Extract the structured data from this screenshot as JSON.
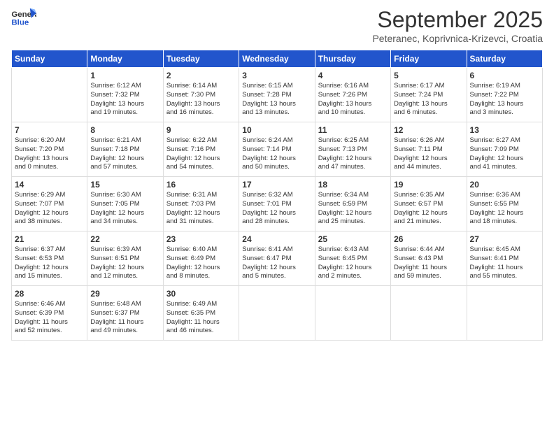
{
  "header": {
    "logo_line1": "General",
    "logo_line2": "Blue",
    "month": "September 2025",
    "location": "Peteranec, Koprivnica-Krizevci, Croatia"
  },
  "weekdays": [
    "Sunday",
    "Monday",
    "Tuesday",
    "Wednesday",
    "Thursday",
    "Friday",
    "Saturday"
  ],
  "weeks": [
    [
      {
        "day": "",
        "content": ""
      },
      {
        "day": "1",
        "content": "Sunrise: 6:12 AM\nSunset: 7:32 PM\nDaylight: 13 hours\nand 19 minutes."
      },
      {
        "day": "2",
        "content": "Sunrise: 6:14 AM\nSunset: 7:30 PM\nDaylight: 13 hours\nand 16 minutes."
      },
      {
        "day": "3",
        "content": "Sunrise: 6:15 AM\nSunset: 7:28 PM\nDaylight: 13 hours\nand 13 minutes."
      },
      {
        "day": "4",
        "content": "Sunrise: 6:16 AM\nSunset: 7:26 PM\nDaylight: 13 hours\nand 10 minutes."
      },
      {
        "day": "5",
        "content": "Sunrise: 6:17 AM\nSunset: 7:24 PM\nDaylight: 13 hours\nand 6 minutes."
      },
      {
        "day": "6",
        "content": "Sunrise: 6:19 AM\nSunset: 7:22 PM\nDaylight: 13 hours\nand 3 minutes."
      }
    ],
    [
      {
        "day": "7",
        "content": "Sunrise: 6:20 AM\nSunset: 7:20 PM\nDaylight: 13 hours\nand 0 minutes."
      },
      {
        "day": "8",
        "content": "Sunrise: 6:21 AM\nSunset: 7:18 PM\nDaylight: 12 hours\nand 57 minutes."
      },
      {
        "day": "9",
        "content": "Sunrise: 6:22 AM\nSunset: 7:16 PM\nDaylight: 12 hours\nand 54 minutes."
      },
      {
        "day": "10",
        "content": "Sunrise: 6:24 AM\nSunset: 7:14 PM\nDaylight: 12 hours\nand 50 minutes."
      },
      {
        "day": "11",
        "content": "Sunrise: 6:25 AM\nSunset: 7:13 PM\nDaylight: 12 hours\nand 47 minutes."
      },
      {
        "day": "12",
        "content": "Sunrise: 6:26 AM\nSunset: 7:11 PM\nDaylight: 12 hours\nand 44 minutes."
      },
      {
        "day": "13",
        "content": "Sunrise: 6:27 AM\nSunset: 7:09 PM\nDaylight: 12 hours\nand 41 minutes."
      }
    ],
    [
      {
        "day": "14",
        "content": "Sunrise: 6:29 AM\nSunset: 7:07 PM\nDaylight: 12 hours\nand 38 minutes."
      },
      {
        "day": "15",
        "content": "Sunrise: 6:30 AM\nSunset: 7:05 PM\nDaylight: 12 hours\nand 34 minutes."
      },
      {
        "day": "16",
        "content": "Sunrise: 6:31 AM\nSunset: 7:03 PM\nDaylight: 12 hours\nand 31 minutes."
      },
      {
        "day": "17",
        "content": "Sunrise: 6:32 AM\nSunset: 7:01 PM\nDaylight: 12 hours\nand 28 minutes."
      },
      {
        "day": "18",
        "content": "Sunrise: 6:34 AM\nSunset: 6:59 PM\nDaylight: 12 hours\nand 25 minutes."
      },
      {
        "day": "19",
        "content": "Sunrise: 6:35 AM\nSunset: 6:57 PM\nDaylight: 12 hours\nand 21 minutes."
      },
      {
        "day": "20",
        "content": "Sunrise: 6:36 AM\nSunset: 6:55 PM\nDaylight: 12 hours\nand 18 minutes."
      }
    ],
    [
      {
        "day": "21",
        "content": "Sunrise: 6:37 AM\nSunset: 6:53 PM\nDaylight: 12 hours\nand 15 minutes."
      },
      {
        "day": "22",
        "content": "Sunrise: 6:39 AM\nSunset: 6:51 PM\nDaylight: 12 hours\nand 12 minutes."
      },
      {
        "day": "23",
        "content": "Sunrise: 6:40 AM\nSunset: 6:49 PM\nDaylight: 12 hours\nand 8 minutes."
      },
      {
        "day": "24",
        "content": "Sunrise: 6:41 AM\nSunset: 6:47 PM\nDaylight: 12 hours\nand 5 minutes."
      },
      {
        "day": "25",
        "content": "Sunrise: 6:43 AM\nSunset: 6:45 PM\nDaylight: 12 hours\nand 2 minutes."
      },
      {
        "day": "26",
        "content": "Sunrise: 6:44 AM\nSunset: 6:43 PM\nDaylight: 11 hours\nand 59 minutes."
      },
      {
        "day": "27",
        "content": "Sunrise: 6:45 AM\nSunset: 6:41 PM\nDaylight: 11 hours\nand 55 minutes."
      }
    ],
    [
      {
        "day": "28",
        "content": "Sunrise: 6:46 AM\nSunset: 6:39 PM\nDaylight: 11 hours\nand 52 minutes."
      },
      {
        "day": "29",
        "content": "Sunrise: 6:48 AM\nSunset: 6:37 PM\nDaylight: 11 hours\nand 49 minutes."
      },
      {
        "day": "30",
        "content": "Sunrise: 6:49 AM\nSunset: 6:35 PM\nDaylight: 11 hours\nand 46 minutes."
      },
      {
        "day": "",
        "content": ""
      },
      {
        "day": "",
        "content": ""
      },
      {
        "day": "",
        "content": ""
      },
      {
        "day": "",
        "content": ""
      }
    ]
  ]
}
